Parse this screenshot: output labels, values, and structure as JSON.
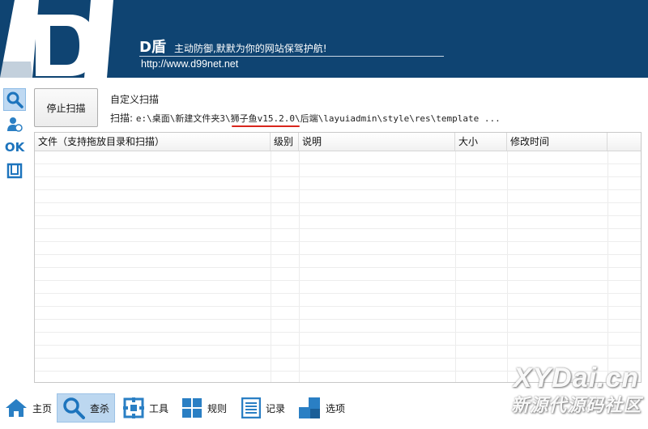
{
  "header": {
    "brand_name": "D盾",
    "slogan": "主动防御,默默为你的网站保驾护航!",
    "url": "http://www.d99net.net"
  },
  "scan": {
    "stop_label": "停止扫描",
    "mode_label": "自定义扫描",
    "path_prefix": "扫描:",
    "path_part1": "e:\\桌面\\新建文件夹3\\",
    "path_highlight": "狮子鱼v15.2.0",
    "path_part2": "\\后端\\layuiadmin\\style\\res\\template ..."
  },
  "table": {
    "columns": [
      "文件（支持拖放目录和扫描）",
      "级别",
      "说明",
      "大小",
      "修改时间"
    ],
    "rows": []
  },
  "toolbar": {
    "items": [
      {
        "label": "主页",
        "icon": "home-icon"
      },
      {
        "label": "查杀",
        "icon": "search-icon"
      },
      {
        "label": "工具",
        "icon": "tools-icon"
      },
      {
        "label": "规则",
        "icon": "grid-icon"
      },
      {
        "label": "记录",
        "icon": "list-icon"
      },
      {
        "label": "选项",
        "icon": "options-icon"
      }
    ]
  },
  "sidebar": {
    "ok_label": "OK"
  },
  "watermark": {
    "line1": "XYDai.cn",
    "line2": "新源代源码社区"
  },
  "colors": {
    "header_bg": "#0f4472",
    "accent": "#2a7fc4",
    "highlight_underline": "#d8261c"
  }
}
